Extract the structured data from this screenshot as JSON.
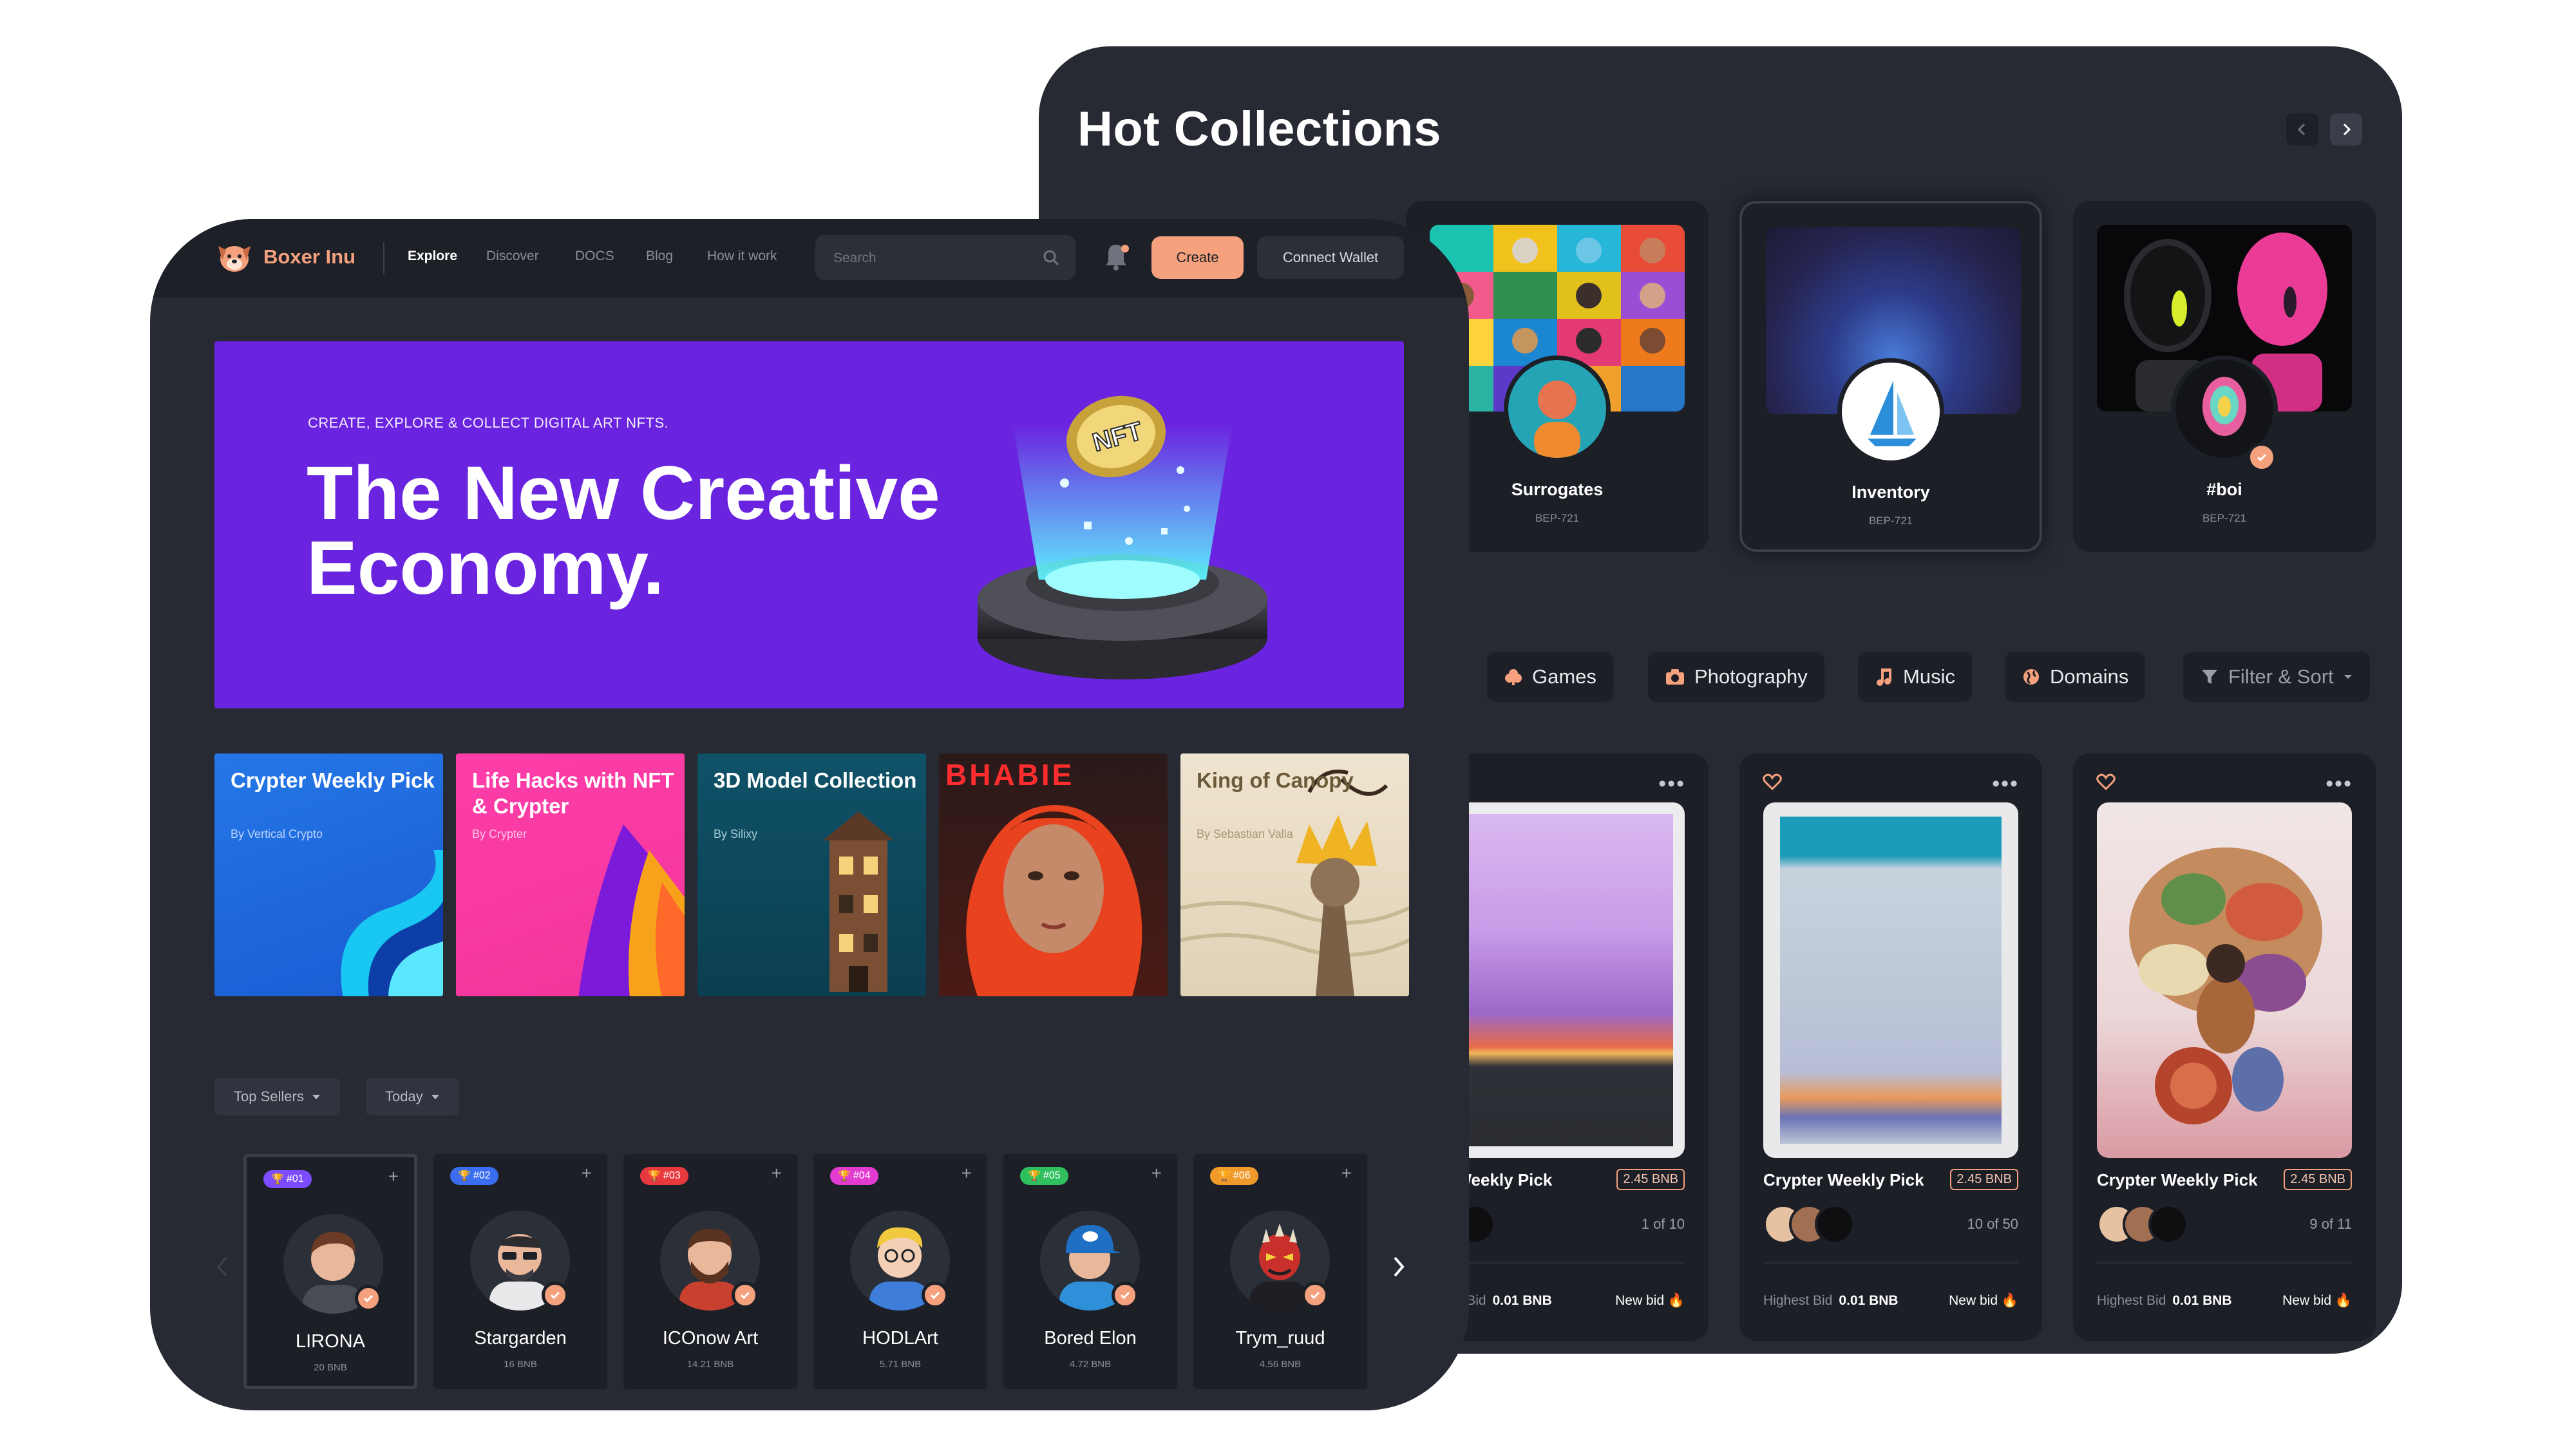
{
  "hot_collections": {
    "title": "Hot Collections",
    "prev_icon": "chevron-left-icon",
    "next_icon": "chevron-right-icon",
    "collections": [
      {
        "name": "Surrogates",
        "standard": "BEP-721"
      },
      {
        "name": "Inventory",
        "standard": "BEP-721"
      },
      {
        "name": "#boi",
        "standard": "BEP-721"
      }
    ]
  },
  "categories": [
    {
      "label": "Games",
      "icon": "spade-icon"
    },
    {
      "label": "Photography",
      "icon": "camera-icon"
    },
    {
      "label": "Music",
      "icon": "music-note-icon"
    },
    {
      "label": "Domains",
      "icon": "globe-icon"
    },
    {
      "label": "Filter & Sort",
      "icon": "funnel-icon"
    }
  ],
  "artworks": [
    {
      "title": "Crypter Weekly Pick",
      "title_shown": "ter Weekly Pick",
      "price": "2.45 BNB",
      "count": "1 of 10",
      "bid_label": "ghest Bid",
      "bid_value": "0.01 BNB",
      "new_bid": "New bid 🔥"
    },
    {
      "title": "Crypter Weekly Pick",
      "price": "2.45 BNB",
      "count": "10 of 50",
      "bid_label": "Highest Bid",
      "bid_value": "0.01 BNB",
      "new_bid": "New bid 🔥"
    },
    {
      "title": "Crypter Weekly Pick",
      "price": "2.45 BNB",
      "count": "9 of 11",
      "bid_label": "Highest Bid",
      "bid_value": "0.01 BNB",
      "new_bid": "New bid 🔥"
    }
  ],
  "topbar": {
    "brand": "Boxer Inu",
    "nav": [
      "Explore",
      "Discover",
      "DOCS",
      "Blog",
      "How it work"
    ],
    "search_placeholder": "Search",
    "create_label": "Create",
    "wallet_label": "Connect Wallet"
  },
  "hero": {
    "eyebrow": "CREATE, EXPLORE & COLLECT DIGITAL ART NFTS.",
    "title": "The New Creative Economy.",
    "coin_text": "NFT"
  },
  "featured": [
    {
      "title": "Crypter Weekly Pick",
      "by": "By Vertical Crypto",
      "bg": "#1e6fe0"
    },
    {
      "title": "Life Hacks with NFT & Crypter",
      "by": "By Crypter",
      "bg": "#f0389a"
    },
    {
      "title": "3D Model Collection",
      "by": "By Silixy",
      "bg": "#0f4e62"
    },
    {
      "title": "",
      "by": "",
      "bg": "#2a1a1a",
      "art_text": "BHABIE"
    },
    {
      "title": "King of Canopy",
      "by": "By Sebastian Valla",
      "bg": "#e7dbc4"
    }
  ],
  "sellers_filter": {
    "primary": "Top Sellers",
    "period": "Today"
  },
  "sellers": [
    {
      "rank": "#01",
      "name": "LIRONA",
      "amount": "20 BNB",
      "color": "#7b4dff"
    },
    {
      "rank": "#02",
      "name": "Stargarden",
      "amount": "16 BNB",
      "color": "#3b6df0"
    },
    {
      "rank": "#03",
      "name": "ICOnow Art",
      "amount": "14.21 BNB",
      "color": "#e8393f"
    },
    {
      "rank": "#04",
      "name": "HODLArt",
      "amount": "5.71 BNB",
      "color": "#e23bd1"
    },
    {
      "rank": "#05",
      "name": "Bored Elon",
      "amount": "4.72 BNB",
      "color": "#2fbf5f"
    },
    {
      "rank": "#06",
      "name": "Trym_ruud",
      "amount": "4.56 BNB",
      "color": "#f09a2b"
    }
  ],
  "colors": {
    "accent": "#f5a17e",
    "panel": "#272a33",
    "card": "#1c1f26",
    "hero": "#6a24e0"
  }
}
